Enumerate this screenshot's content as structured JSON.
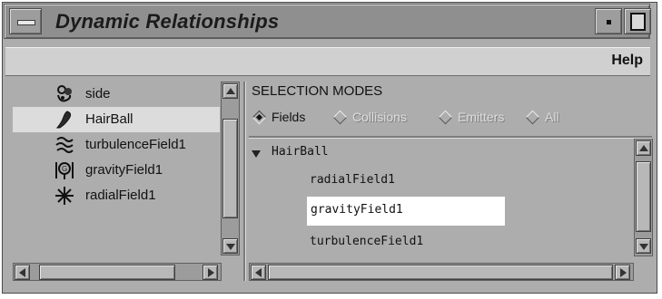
{
  "window": {
    "title": "Dynamic Relationships"
  },
  "menubar": {
    "help_label": "Help"
  },
  "object_list": {
    "items": [
      {
        "label": "side",
        "icon": "character-icon",
        "selected": false
      },
      {
        "label": "HairBall",
        "icon": "hair-curve-icon",
        "selected": true
      },
      {
        "label": "turbulenceField1",
        "icon": "turbulence-field-icon",
        "selected": false
      },
      {
        "label": "gravityField1",
        "icon": "gravity-field-icon",
        "selected": false
      },
      {
        "label": "radialField1",
        "icon": "radial-field-icon",
        "selected": false
      }
    ]
  },
  "selection_modes": {
    "title": "SELECTION MODES",
    "options": [
      {
        "label": "Fields",
        "checked": true,
        "enabled": true
      },
      {
        "label": "Collisions",
        "checked": false,
        "enabled": false
      },
      {
        "label": "Emitters",
        "checked": false,
        "enabled": false
      },
      {
        "label": "All",
        "checked": false,
        "enabled": false
      }
    ]
  },
  "tree": {
    "root": "HairBall",
    "children": [
      "radialField1",
      "gravityField1",
      "turbulenceField1"
    ],
    "selected": "gravityField1"
  },
  "colors": {
    "window_bg": "#adadad",
    "selection_bg": "#ffffff",
    "list_selection_bg": "#dcdcdc"
  }
}
